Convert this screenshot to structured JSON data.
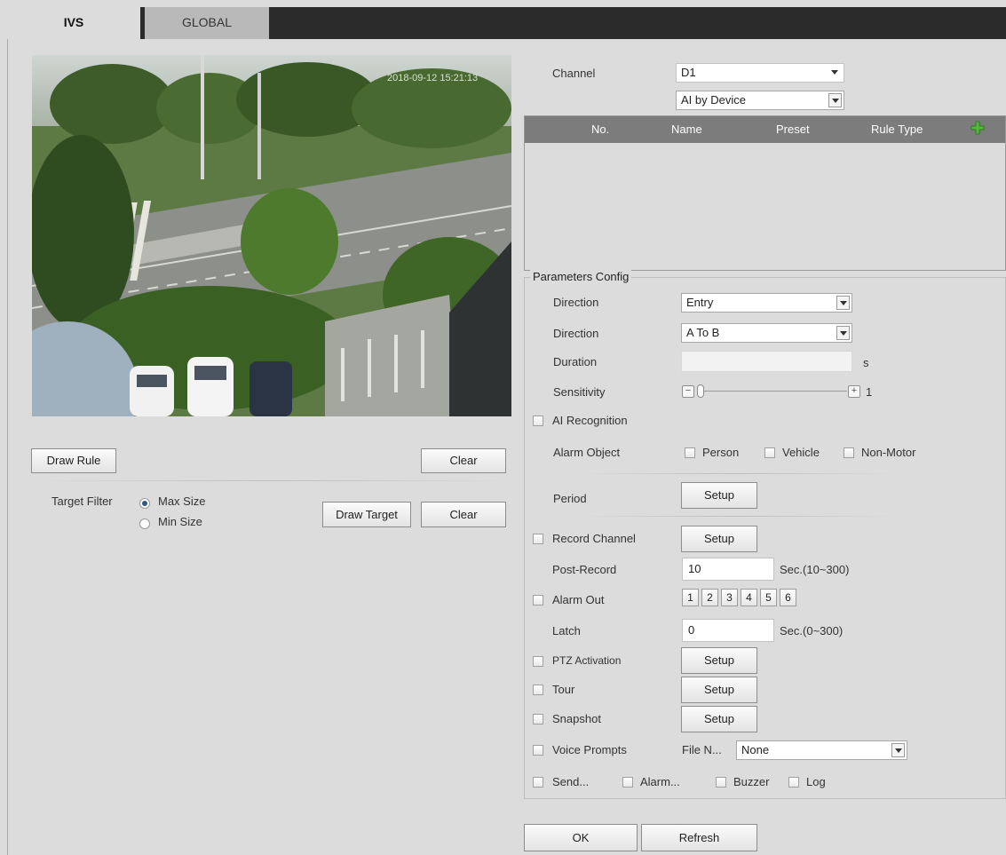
{
  "tabs": [
    {
      "label": "IVS",
      "active": true
    },
    {
      "label": "GLOBAL",
      "active": false
    }
  ],
  "video": {
    "timestamp": "2018-09-12 15:21:13"
  },
  "left": {
    "draw_rule": "Draw Rule",
    "clear1": "Clear",
    "target_filter_label": "Target Filter",
    "max_size": "Max Size",
    "min_size": "Min Size",
    "selected_size": "Max Size",
    "draw_target": "Draw Target",
    "clear2": "Clear"
  },
  "channel": {
    "label": "Channel",
    "value": "D1",
    "mode": "AI by Device"
  },
  "rule_table": {
    "columns": [
      "No.",
      "Name",
      "Preset",
      "Rule Type"
    ],
    "rows": []
  },
  "params": {
    "legend": "Parameters Config",
    "direction1_label": "Direction",
    "direction1_value": "Entry",
    "direction2_label": "Direction",
    "direction2_value": "A To B",
    "duration_label": "Duration",
    "duration_value": "",
    "duration_unit": "s",
    "sensitivity_label": "Sensitivity",
    "sensitivity_value": "1",
    "sensitivity_min_symbol": "−",
    "sensitivity_plus_symbol": "+",
    "ai_recognition": "AI Recognition",
    "alarm_object_label": "Alarm Object",
    "alarm_objects": [
      "Person",
      "Vehicle",
      "Non-Motor"
    ],
    "period_label": "Period",
    "setup": "Setup",
    "record_channel": "Record Channel",
    "post_record_label": "Post-Record",
    "post_record_value": "10",
    "post_record_range": "Sec.(10~300)",
    "alarm_out": "Alarm Out",
    "alarm_out_numbers": [
      "1",
      "2",
      "3",
      "4",
      "5",
      "6"
    ],
    "latch_label": "Latch",
    "latch_value": "0",
    "latch_range": "Sec.(0~300)",
    "ptz_activation": "PTZ Activation",
    "tour": "Tour",
    "snapshot": "Snapshot",
    "voice_prompts": "Voice Prompts",
    "file_name_label": "File N...",
    "file_name_value": "None",
    "send": "Send...",
    "alarm": "Alarm...",
    "buzzer": "Buzzer",
    "log": "Log"
  },
  "footer": {
    "ok": "OK",
    "refresh": "Refresh"
  },
  "colors": {
    "background": "#dcdcdc",
    "tabbar": "#2b2b2b",
    "table_header": "#7c7c7c",
    "add_icon": "#4caf2f"
  }
}
